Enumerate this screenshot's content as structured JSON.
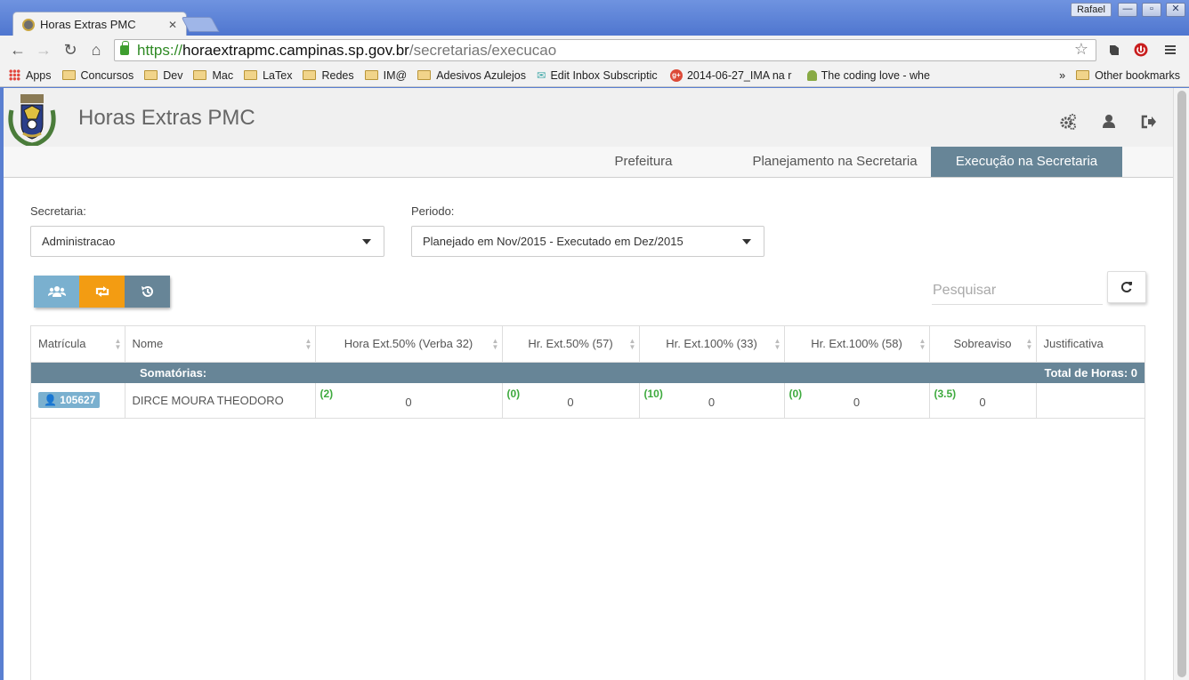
{
  "browser": {
    "tab_title": "Horas Extras PMC",
    "user_name": "Rafael",
    "url_scheme": "https://",
    "url_host": "horaextrapmc.campinas.sp.gov.br",
    "url_path": "/secretarias/execucao",
    "bookmarks": [
      "Apps",
      "Concursos",
      "Dev",
      "Mac",
      "LaTex",
      "Redes",
      "IM@",
      "Adesivos Azulejos",
      "Edit Inbox Subscriptic",
      "2014-06-27_IMA na r",
      "The coding love - whe"
    ],
    "more_bookmarks": "»",
    "other_bookmarks": "Other bookmarks"
  },
  "app": {
    "title": "Horas Extras PMC",
    "nav": [
      "Prefeitura",
      "Planejamento na Secretaria",
      "Execução na Secretaria"
    ],
    "active_nav": "Execução na Secretaria"
  },
  "filters": {
    "secretaria_label": "Secretaria:",
    "secretaria_value": "Administracao",
    "periodo_label": "Periodo:",
    "periodo_value": "Planejado em Nov/2015 - Executado em Dez/2015"
  },
  "search": {
    "placeholder": "Pesquisar"
  },
  "table": {
    "columns": [
      "Matrícula",
      "Nome",
      "Hora Ext.50% (Verba 32)",
      "Hr. Ext.50% (57)",
      "Hr. Ext.100% (33)",
      "Hr. Ext.100% (58)",
      "Sobreaviso",
      "Justificativa"
    ],
    "summary_label": "Somatórias:",
    "summary_total": "Total de Horas: 0",
    "rows": [
      {
        "matricula": "105627",
        "nome": "DIRCE MOURA THEODORO",
        "values": [
          {
            "limit": "(2)",
            "value": "0"
          },
          {
            "limit": "(0)",
            "value": "0"
          },
          {
            "limit": "(10)",
            "value": "0"
          },
          {
            "limit": "(0)",
            "value": "0"
          },
          {
            "limit": "(3.5)",
            "value": "0"
          }
        ],
        "justificativa": ""
      }
    ]
  },
  "colors": {
    "accent": "#678597",
    "btn_users": "#7ab0cf",
    "btn_transfer": "#f39c12",
    "btn_history": "#678597",
    "limit_green": "#3eaa3e"
  }
}
